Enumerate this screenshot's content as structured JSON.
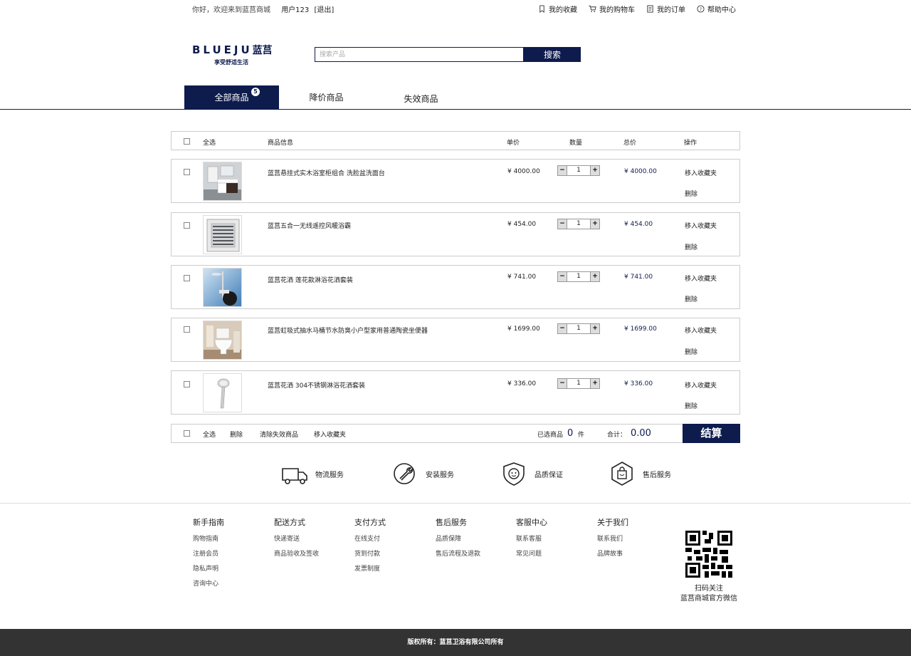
{
  "topbar": {
    "welcome": "你好，欢迎来到蓝莒商城",
    "user": "用户123",
    "logout": "[退出]",
    "links": [
      {
        "label": "我的收藏",
        "icon": "bookmark-icon"
      },
      {
        "label": "我的购物车",
        "icon": "cart-icon"
      },
      {
        "label": "我的订单",
        "icon": "order-icon"
      },
      {
        "label": "帮助中心",
        "icon": "help-icon"
      }
    ]
  },
  "logo": {
    "en": "BLUEJU",
    "cn": "蓝莒",
    "slogan": "享受舒适生活"
  },
  "search": {
    "placeholder": "搜索产品",
    "button": "搜索"
  },
  "tabs": [
    {
      "label": "全部商品",
      "badge": "5",
      "active": true
    },
    {
      "label": "降价商品",
      "active": false
    },
    {
      "label": "失效商品",
      "active": false
    }
  ],
  "cart_head": {
    "select_all": "全选",
    "info": "商品信息",
    "price": "单价",
    "qty": "数量",
    "total": "总价",
    "action": "操作"
  },
  "items": [
    {
      "name": "蓝莒悬挂式实木浴室柜组合 洗脸盆洗面台",
      "price": "¥ 4000.00",
      "qty": "1",
      "total": "¥ 4000.00",
      "fav": "移入收藏夹",
      "del": "删除"
    },
    {
      "name": "蓝莒五合一无线遥控风暖浴霸",
      "price": "¥ 454.00",
      "qty": "1",
      "total": "¥ 454.00",
      "fav": "移入收藏夹",
      "del": "删除"
    },
    {
      "name": "蓝莒花洒 莲花款淋浴花洒套装",
      "price": "¥ 741.00",
      "qty": "1",
      "total": "¥ 741.00",
      "fav": "移入收藏夹",
      "del": "删除"
    },
    {
      "name": "蓝莒虹吸式抽水马桶节水防臭小户型家用普通陶瓷坐便器",
      "price": "¥ 1699.00",
      "qty": "1",
      "total": "¥ 1699.00",
      "fav": "移入收藏夹",
      "del": "删除"
    },
    {
      "name": "蓝莒花洒 304不锈钢淋浴花洒套装",
      "price": "¥ 336.00",
      "qty": "1",
      "total": "¥ 336.00",
      "fav": "移入收藏夹",
      "del": "删除"
    }
  ],
  "cart_foot": {
    "select_all": "全选",
    "delete": "删除",
    "clear_invalid": "清除失效商品",
    "move_fav": "移入收藏夹",
    "selected_label": "已选商品",
    "selected_count": "0",
    "unit": "件",
    "sum_label": "合计：",
    "sum_value": "0.00",
    "checkout": "结算"
  },
  "services": [
    {
      "label": "物流服务",
      "icon": "truck-icon"
    },
    {
      "label": "安装服务",
      "icon": "wrench-icon"
    },
    {
      "label": "品质保证",
      "icon": "shield-icon"
    },
    {
      "label": "售后服务",
      "icon": "bag-icon"
    }
  ],
  "footer": [
    {
      "title": "新手指南",
      "links": [
        "购物指南",
        "注册会员",
        "隐私声明",
        "咨询中心"
      ]
    },
    {
      "title": "配送方式",
      "links": [
        "快递寄送",
        "商品验收及签收"
      ]
    },
    {
      "title": "支付方式",
      "links": [
        "在线支付",
        "货到付款",
        "发票制度"
      ]
    },
    {
      "title": "售后服务",
      "links": [
        "品质保障",
        "售后流程及退款"
      ]
    },
    {
      "title": "客服中心",
      "links": [
        "联系客服",
        "常见问题"
      ]
    },
    {
      "title": "关于我们",
      "links": [
        "联系我们",
        "品牌故事"
      ]
    }
  ],
  "qr": {
    "line1": "扫码关注",
    "line2": "蓝莒商城官方微信"
  },
  "copyright": "版权所有：蓝莒卫浴有限公司所有",
  "colors": {
    "brand": "#0d1b4d"
  }
}
